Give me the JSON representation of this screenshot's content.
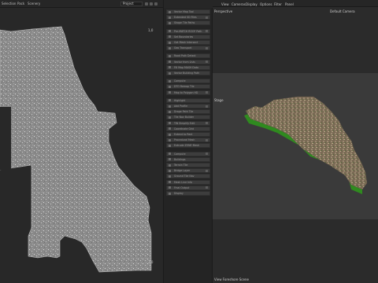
{
  "menu": {
    "items": [
      "Selection",
      "Pack",
      "Scenery"
    ],
    "project": "Project"
  },
  "left_view": {
    "top_right_value": "1,0",
    "bottom_right_value": "1,0"
  },
  "node_list": [
    "Vector Map Tool",
    "Extended SD Files",
    "Shape Tile Paths",
    "",
    "Pre-MATCH ROOF Path",
    "Set Boundaries",
    "Get Mesh Intersect",
    "Geo Transport",
    "",
    "Road Path Detect",
    "Vector from Lists",
    "Fill Map MASH Data",
    "Vector Building Path",
    "",
    "Compute",
    "DTO Remap Tile",
    "Map to Polygon HD",
    "",
    "Highlight",
    "Add Profile",
    "Drape Path Tile",
    "Tile Nav Builder",
    "TIN Simplify Edit",
    "Coordinate Grid",
    "Extend to Rect",
    "Procedural Mesh",
    "Extrude ZONE Mesh",
    "",
    "Compute",
    "Buildings",
    "Terrain Tile",
    "Bridge Layer",
    "Ground Tile Nav",
    "Mesh Line Info",
    "Final Output",
    "Display"
  ],
  "right_panel": {
    "menu": [
      "View",
      "Cameras",
      "Display",
      "Options",
      "Filter",
      "Panel"
    ],
    "perspective_label": "Perspective",
    "camera_label": "Default Camera",
    "object_label": "Stage",
    "status": "View Foreshore Scene"
  }
}
